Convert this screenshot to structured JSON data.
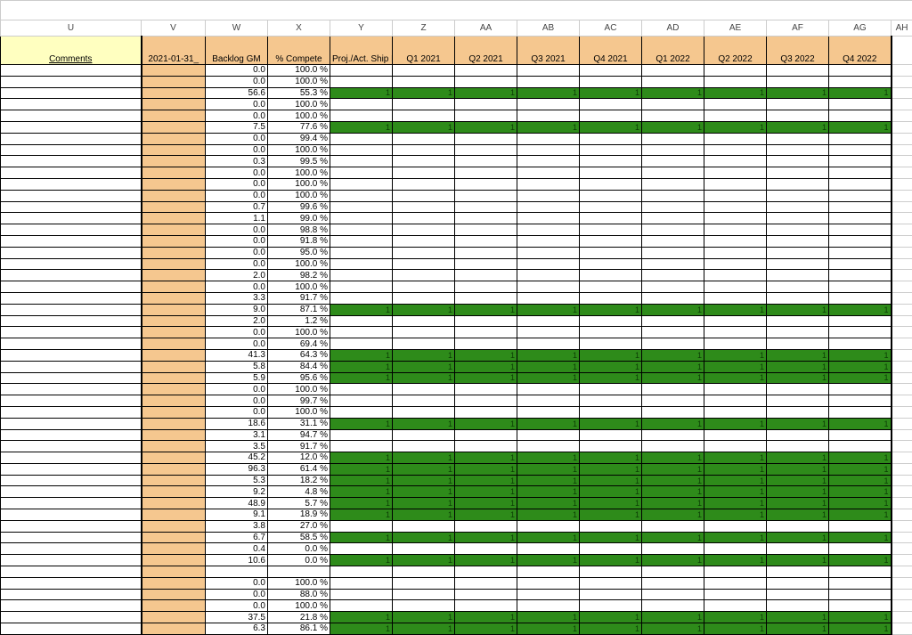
{
  "columns": {
    "letters": [
      "U",
      "V",
      "W",
      "X",
      "Y",
      "Z",
      "AA",
      "AB",
      "AC",
      "AD",
      "AE",
      "AF",
      "AG",
      "AH"
    ],
    "headers": {
      "U": "Comments",
      "V": "2021-01-31_",
      "W": "Backlog GM",
      "X": "% Compete",
      "Y": "Proj./Act. Ship Date",
      "Z": "Q1 2021",
      "AA": "Q2 2021",
      "AB": "Q3 2021",
      "AC": "Q4 2021",
      "AD": "Q1 2022",
      "AE": "Q2 2022",
      "AF": "Q3 2022",
      "AG": "Q4 2022"
    }
  },
  "rows": [
    {
      "w": "0.0",
      "x": "100.0 %",
      "q": null
    },
    {
      "w": "0.0",
      "x": "100.0 %",
      "q": null
    },
    {
      "w": "56.6",
      "x": "55.3 %",
      "q": "1"
    },
    {
      "w": "0.0",
      "x": "100.0 %",
      "q": null
    },
    {
      "w": "0.0",
      "x": "100.0 %",
      "q": null
    },
    {
      "w": "7.5",
      "x": "77.6 %",
      "q": "1"
    },
    {
      "w": "0.0",
      "x": "99.4 %",
      "q": null
    },
    {
      "w": "0.0",
      "x": "100.0 %",
      "q": null
    },
    {
      "w": "0.3",
      "x": "99.5 %",
      "q": null
    },
    {
      "w": "0.0",
      "x": "100.0 %",
      "q": null
    },
    {
      "w": "0.0",
      "x": "100.0 %",
      "q": null
    },
    {
      "w": "0.0",
      "x": "100.0 %",
      "q": null
    },
    {
      "w": "0.7",
      "x": "99.6 %",
      "q": null
    },
    {
      "w": "1.1",
      "x": "99.0 %",
      "q": null
    },
    {
      "w": "0.0",
      "x": "98.8 %",
      "q": null
    },
    {
      "w": "0.0",
      "x": "91.8 %",
      "q": null
    },
    {
      "w": "0.0",
      "x": "95.0 %",
      "q": null
    },
    {
      "w": "0.0",
      "x": "100.0 %",
      "q": null
    },
    {
      "w": "2.0",
      "x": "98.2 %",
      "q": null
    },
    {
      "w": "0.0",
      "x": "100.0 %",
      "q": null
    },
    {
      "w": "3.3",
      "x": "91.7 %",
      "q": null
    },
    {
      "w": "9.0",
      "x": "87.1 %",
      "q": "1"
    },
    {
      "w": "2.0",
      "x": "1.2 %",
      "q": null
    },
    {
      "w": "0.0",
      "x": "100.0 %",
      "q": null
    },
    {
      "w": "0.0",
      "x": "69.4 %",
      "q": null
    },
    {
      "w": "41.3",
      "x": "64.3 %",
      "q": "1"
    },
    {
      "w": "5.8",
      "x": "84.4 %",
      "q": "1"
    },
    {
      "w": "5.9",
      "x": "95.6 %",
      "q": "1"
    },
    {
      "w": "0.0",
      "x": "100.0 %",
      "q": null
    },
    {
      "w": "0.0",
      "x": "99.7 %",
      "q": null
    },
    {
      "w": "0.0",
      "x": "100.0 %",
      "q": null
    },
    {
      "w": "18.6",
      "x": "31.1 %",
      "q": "1"
    },
    {
      "w": "3.1",
      "x": "94.7 %",
      "q": null
    },
    {
      "w": "3.5",
      "x": "91.7 %",
      "q": null
    },
    {
      "w": "45.2",
      "x": "12.0 %",
      "q": "1"
    },
    {
      "w": "96.3",
      "x": "61.4 %",
      "q": "1"
    },
    {
      "w": "5.3",
      "x": "18.2 %",
      "q": "1"
    },
    {
      "w": "9.2",
      "x": "4.8 %",
      "q": "1"
    },
    {
      "w": "48.9",
      "x": "5.7 %",
      "q": "1"
    },
    {
      "w": "9.1",
      "x": "18.9 %",
      "q": "1"
    },
    {
      "w": "3.8",
      "x": "27.0 %",
      "q": null
    },
    {
      "w": "6.7",
      "x": "58.5 %",
      "q": "1"
    },
    {
      "w": "0.4",
      "x": "0.0 %",
      "q": null
    },
    {
      "w": "10.6",
      "x": "0.0 %",
      "q": "1"
    },
    {
      "w": "",
      "x": "",
      "q": null
    },
    {
      "w": "0.0",
      "x": "100.0 %",
      "q": null
    },
    {
      "w": "0.0",
      "x": "88.0 %",
      "q": null
    },
    {
      "w": "0.0",
      "x": "100.0 %",
      "q": null
    },
    {
      "w": "37.5",
      "x": "21.8 %",
      "q": "1"
    },
    {
      "w": "6.3",
      "x": "86.1 %",
      "q": "1"
    }
  ]
}
